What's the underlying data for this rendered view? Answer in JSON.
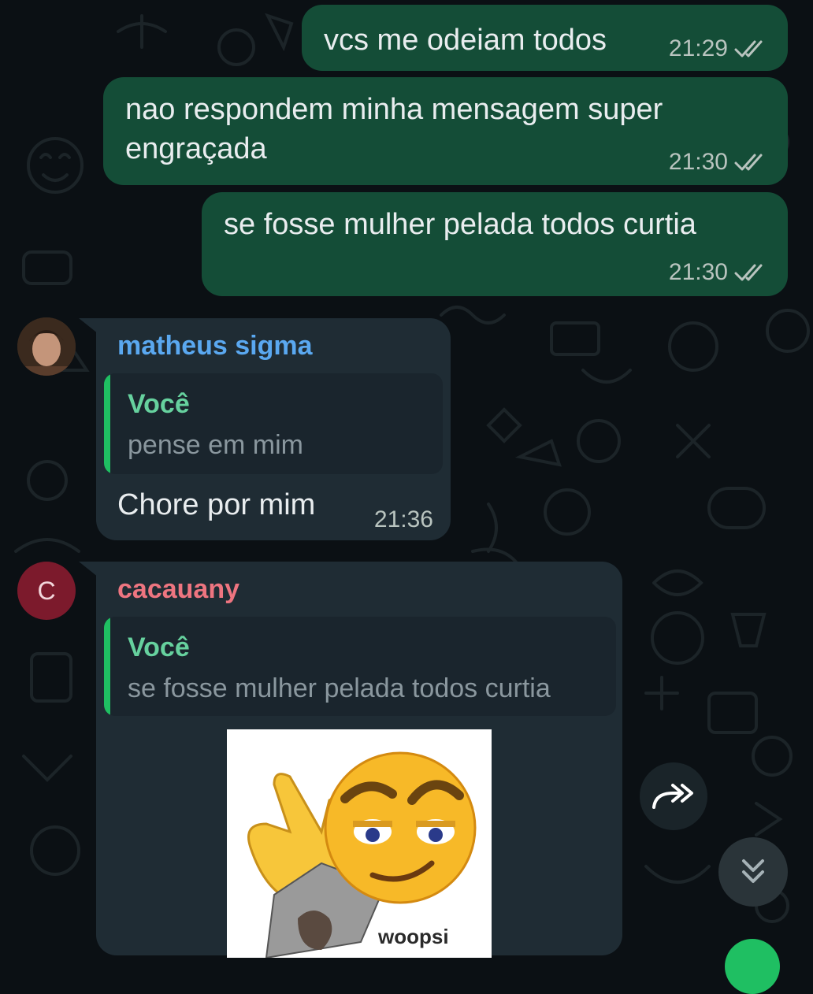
{
  "chat": {
    "messages": [
      {
        "direction": "out",
        "text": "vcs me odeiam todos",
        "time": "21:29",
        "status_icon": "double-check-icon"
      },
      {
        "direction": "out",
        "text": "nao respondem minha mensagem super engraçada",
        "time": "21:30",
        "status_icon": "double-check-icon"
      },
      {
        "direction": "out",
        "text": "se fosse mulher pelada todos curtia",
        "time": "21:30",
        "status_icon": "double-check-icon"
      },
      {
        "direction": "in",
        "sender": "matheus sigma",
        "sender_color": "#5aa8f0",
        "reply": {
          "author": "Você",
          "text": "pense em mim"
        },
        "text": "Chore por mim",
        "time": "21:36"
      },
      {
        "direction": "in",
        "sender": "cacauany",
        "sender_color": "#ee7580",
        "avatar_initial": "C",
        "avatar_color": "#7c1a2c",
        "reply": {
          "author": "Você",
          "text": "se fosse mulher pelada todos curtia"
        },
        "sticker": {
          "caption": "woopsi",
          "icon": "smirking-emoji-sticker"
        }
      }
    ]
  },
  "actions": {
    "forward_icon": "forward-icon",
    "scroll_down_icon": "double-chevron-down-icon"
  },
  "colors": {
    "background": "#0b1014",
    "outgoing_bubble": "#144d37",
    "incoming_bubble": "#1f2c34",
    "quote_accent": "#1fbf62"
  }
}
